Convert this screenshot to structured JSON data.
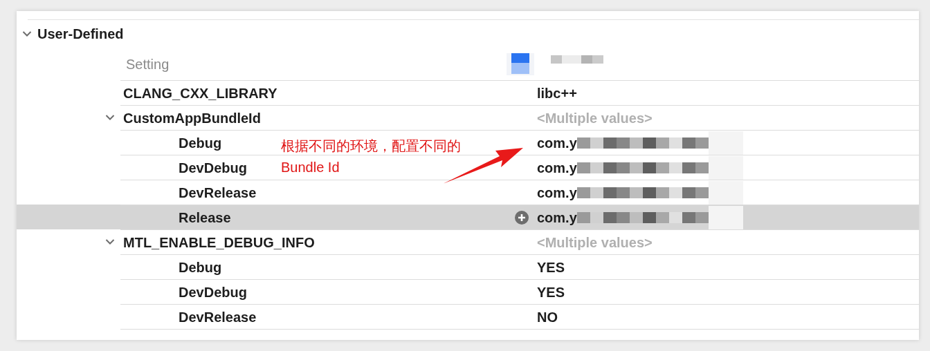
{
  "section": {
    "title": "User-Defined",
    "expanded": true
  },
  "column_header": {
    "label": "Setting"
  },
  "settings": [
    {
      "name": "CLANG_CXX_LIBRARY",
      "value": "libc++",
      "kind": "plain",
      "selected": false
    },
    {
      "name": "CustomAppBundleId",
      "value": "<Multiple values>",
      "kind": "multiple",
      "selected": false,
      "expanded": true,
      "children": [
        {
          "name": "Debug",
          "value": "com.y",
          "kind": "redacted",
          "selected": false
        },
        {
          "name": "DevDebug",
          "value": "com.y",
          "kind": "redacted",
          "selected": false
        },
        {
          "name": "DevRelease",
          "value": "com.y",
          "kind": "redacted",
          "selected": false
        },
        {
          "name": "Release",
          "value": "com.y",
          "kind": "redacted",
          "selected": true
        }
      ]
    },
    {
      "name": "MTL_ENABLE_DEBUG_INFO",
      "value": "<Multiple values>",
      "kind": "multiple",
      "selected": false,
      "expanded": true,
      "children": [
        {
          "name": "Debug",
          "value": "YES",
          "kind": "plain",
          "selected": false
        },
        {
          "name": "DevDebug",
          "value": "YES",
          "kind": "plain",
          "selected": false
        },
        {
          "name": "DevRelease",
          "value": "NO",
          "kind": "plain",
          "selected": false
        }
      ]
    }
  ],
  "annotation": {
    "lines": [
      "根据不同的环境，配置不同的",
      "Bundle Id"
    ]
  }
}
